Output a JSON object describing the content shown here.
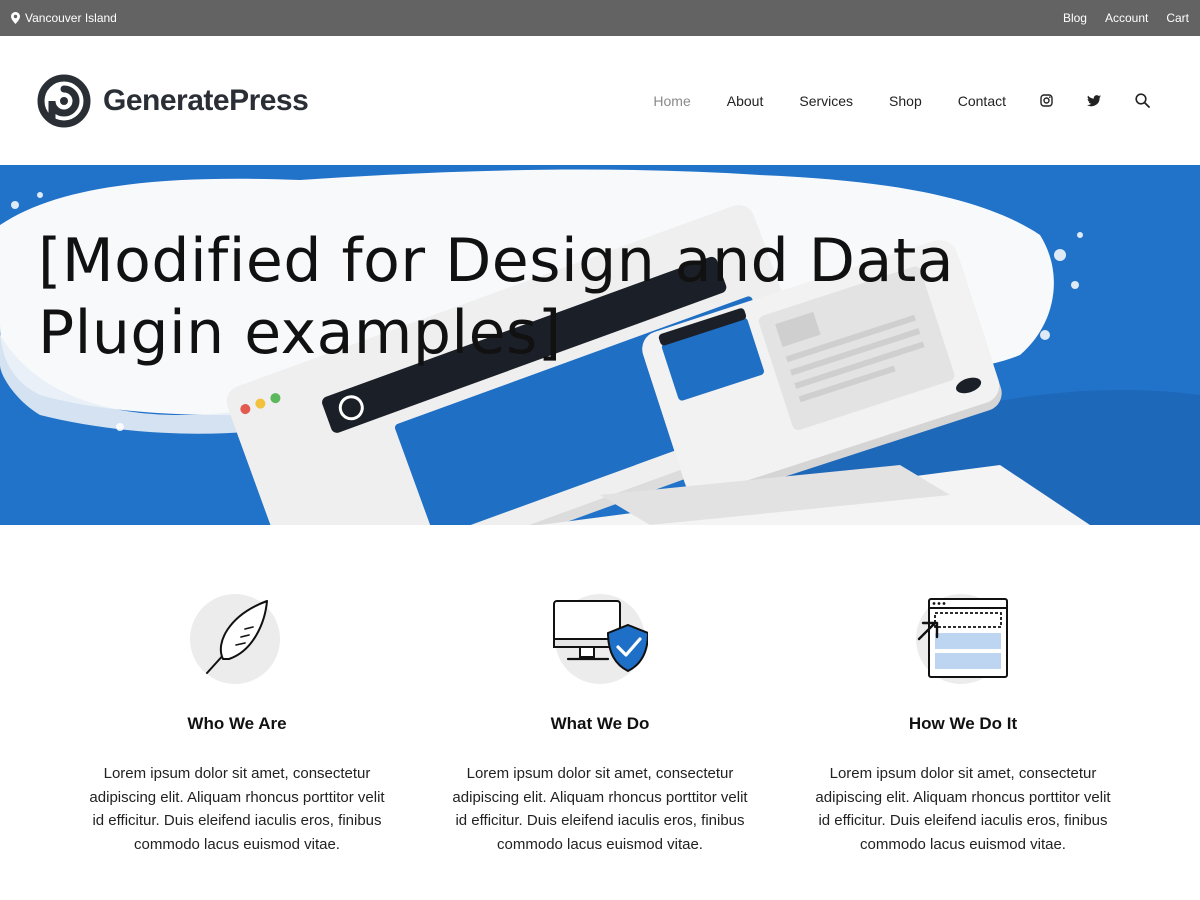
{
  "topbar": {
    "location": "Vancouver Island",
    "links": [
      "Blog",
      "Account",
      "Cart"
    ]
  },
  "header": {
    "brand": "GeneratePress",
    "nav": [
      "Home",
      "About",
      "Services",
      "Shop",
      "Contact"
    ],
    "active_nav": "Home",
    "icons": [
      "instagram-icon",
      "twitter-icon",
      "search-icon"
    ]
  },
  "hero": {
    "title_line1": "[Modified for Design and Data",
    "title_line2": "Plugin examples]"
  },
  "features": [
    {
      "icon": "feather-icon",
      "title": "Who We Are",
      "text": "Lorem ipsum dolor sit amet, consectetur adipiscing elit. Aliquam rhoncus porttitor velit id efficitur. Duis eleifend iaculis eros, finibus commodo lacus euismod vitae."
    },
    {
      "icon": "monitor-shield-icon",
      "title": "What We Do",
      "text": "Lorem ipsum dolor sit amet, consectetur adipiscing elit. Aliquam rhoncus porttitor velit id efficitur. Duis eleifend iaculis eros, finibus commodo lacus euismod vitae."
    },
    {
      "icon": "browser-cursor-icon",
      "title": "How We Do It",
      "text": "Lorem ipsum dolor sit amet, consectetur adipiscing elit. Aliquam rhoncus porttitor velit id efficitur. Duis eleifend iaculis eros, finibus commodo lacus euismod vitae."
    }
  ],
  "colors": {
    "topbar": "#636363",
    "hero_blue": "#2172c9",
    "brand_dark": "#2a2e35",
    "nav_active": "#8a8a8a"
  }
}
